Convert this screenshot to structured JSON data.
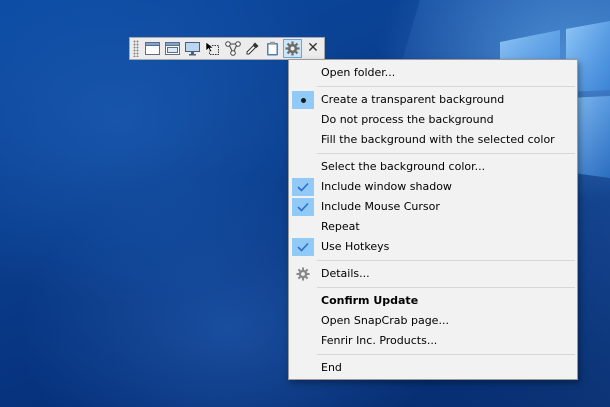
{
  "toolbar": {
    "buttons": [
      {
        "icon": "window-capture-icon"
      },
      {
        "icon": "client-area-capture-icon"
      },
      {
        "icon": "fullscreen-capture-icon"
      },
      {
        "icon": "region-select-icon"
      },
      {
        "icon": "object-capture-icon"
      },
      {
        "icon": "eyedropper-icon"
      },
      {
        "icon": "clipboard-icon"
      },
      {
        "icon": "gear-icon",
        "active": true
      }
    ],
    "close_label": "✕"
  },
  "menu": {
    "open_folder": "Open folder...",
    "bg_transparent": "Create a transparent background",
    "bg_none": "Do not process the background",
    "bg_fill": "Fill the background with the selected color",
    "select_bg_color": "Select the background color...",
    "include_shadow": "Include window shadow",
    "include_cursor": "Include Mouse Cursor",
    "repeat": "Repeat",
    "use_hotkeys": "Use Hotkeys",
    "details": "Details...",
    "confirm_update": "Confirm Update",
    "open_page": "Open SnapCrab page...",
    "products": "Fenrir Inc. Products...",
    "end": "End"
  },
  "colors": {
    "desktop_blue": "#0a3f8e",
    "menu_bg": "#f2f2f2",
    "check_highlight": "#91c9f7",
    "check_mark": "#2a6fc9"
  }
}
